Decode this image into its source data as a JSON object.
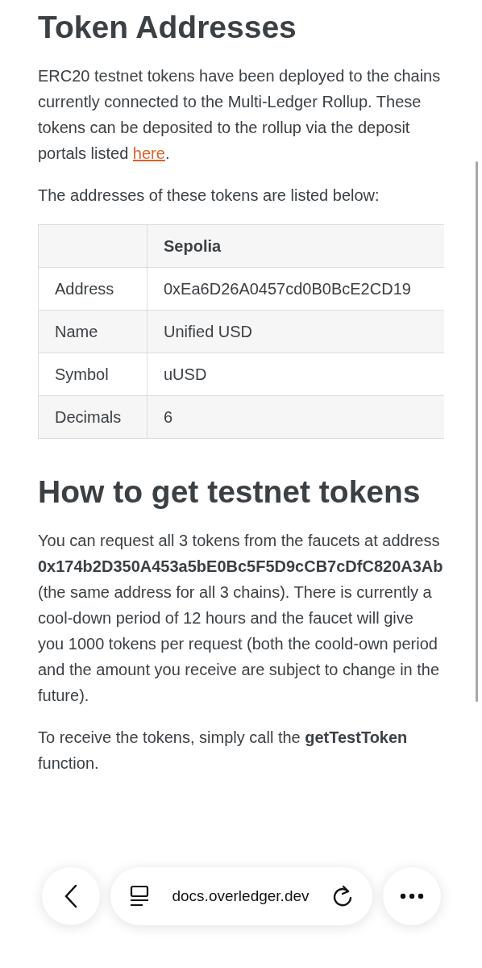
{
  "sections": [
    {
      "heading": "Token Addresses",
      "paragraphs": [
        {
          "text": "ERC20 testnet tokens have been deployed to the chains currently connected to the Multi-Ledger Rollup. These tokens can be deposited to the rollup via the deposit portals listed ",
          "link": "here",
          "after": "."
        },
        {
          "text": "The addresses of these tokens are listed below:"
        }
      ],
      "table": {
        "columns": [
          "",
          "Sepolia"
        ],
        "rows": [
          [
            "Address",
            "0xEa6D26A0457cd0B0BcE2CD19"
          ],
          [
            "Name",
            "Unified USD"
          ],
          [
            "Symbol",
            "uUSD"
          ],
          [
            "Decimals",
            "6"
          ]
        ]
      }
    },
    {
      "heading": "How to get testnet tokens",
      "paragraphs": [
        {
          "text": "You can request all 3 tokens from the faucets at address **0x174b2D350A453a5bE0Bc5F5D9cCB7cDfC820A3Ab** (the same address for all 3 chains). There is currently a cool-down period of 12 hours and the faucet will give you 1000 tokens per request (both the coold-own period and the amount you receive are subject to change in the future)."
        },
        {
          "text": "To receive the tokens, simply call the **getTestToken** function."
        }
      ]
    }
  ],
  "browser_bar": {
    "url": "docs.overledger.dev"
  }
}
